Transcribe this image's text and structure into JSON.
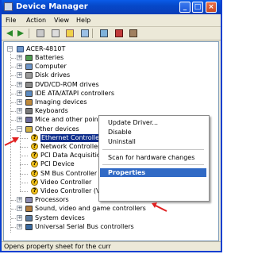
{
  "window": {
    "title": "Device Manager"
  },
  "titlebar_buttons": {
    "minimize": "_",
    "maximize": "□",
    "close": "×"
  },
  "menu": [
    "File",
    "Action",
    "View",
    "Help"
  ],
  "toolbar_icons": [
    "back-icon",
    "forward-icon",
    "properties-icon",
    "print-icon",
    "help-icon",
    "scan-hardware-icon",
    "update-driver-icon",
    "uninstall-icon",
    "disable-icon"
  ],
  "tree": {
    "root": "ACER-4810T",
    "categories": [
      "Batteries",
      "Computer",
      "Disk drives",
      "DVD/CD-ROM drives",
      "IDE ATA/ATAPI controllers",
      "Imaging devices",
      "Keyboards",
      "Mice and other pointing devices",
      "Other devices"
    ],
    "other_devices": [
      "Ethernet Controller",
      "Network Controller",
      "PCI Data Acquisitic",
      "PCI Device",
      "SM Bus Controller",
      "Video Controller",
      "Video Controller (V"
    ],
    "after": [
      "Processors",
      "Sound, video and game controllers",
      "System devices",
      "Universal Serial Bus controllers"
    ]
  },
  "context_menu": {
    "items": [
      "Update Driver...",
      "Disable",
      "Uninstall",
      "Scan for hardware changes",
      "Properties"
    ],
    "highlighted": "Properties"
  },
  "status": "Opens property sheet for the curr",
  "colors": {
    "titlebar": "#0648c9",
    "selection": "#0b2b8a",
    "menu_highlight": "#316ac5",
    "arrow": "#e02020",
    "warning": "#f3c21c"
  }
}
